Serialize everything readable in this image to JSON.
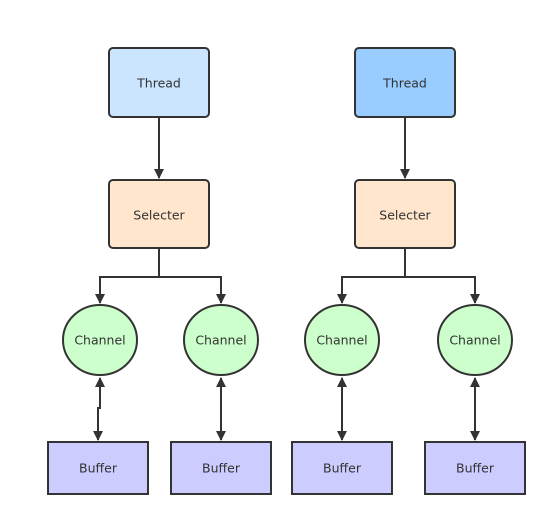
{
  "colors": {
    "thread_left": "#cce5ff",
    "thread_right": "#99ccff",
    "selecter": "#ffe6cc",
    "channel": "#ccffcc",
    "buffer": "#ccccff",
    "stroke": "#333333"
  },
  "groups": [
    {
      "thread": "Thread",
      "selecter": "Selecter",
      "channels": [
        {
          "channel": "Channel",
          "buffer": "Buffer"
        },
        {
          "channel": "Channel",
          "buffer": "Buffer"
        }
      ]
    },
    {
      "thread": "Thread",
      "selecter": "Selecter",
      "channels": [
        {
          "channel": "Channel",
          "buffer": "Buffer"
        },
        {
          "channel": "Channel",
          "buffer": "Buffer"
        }
      ]
    }
  ]
}
